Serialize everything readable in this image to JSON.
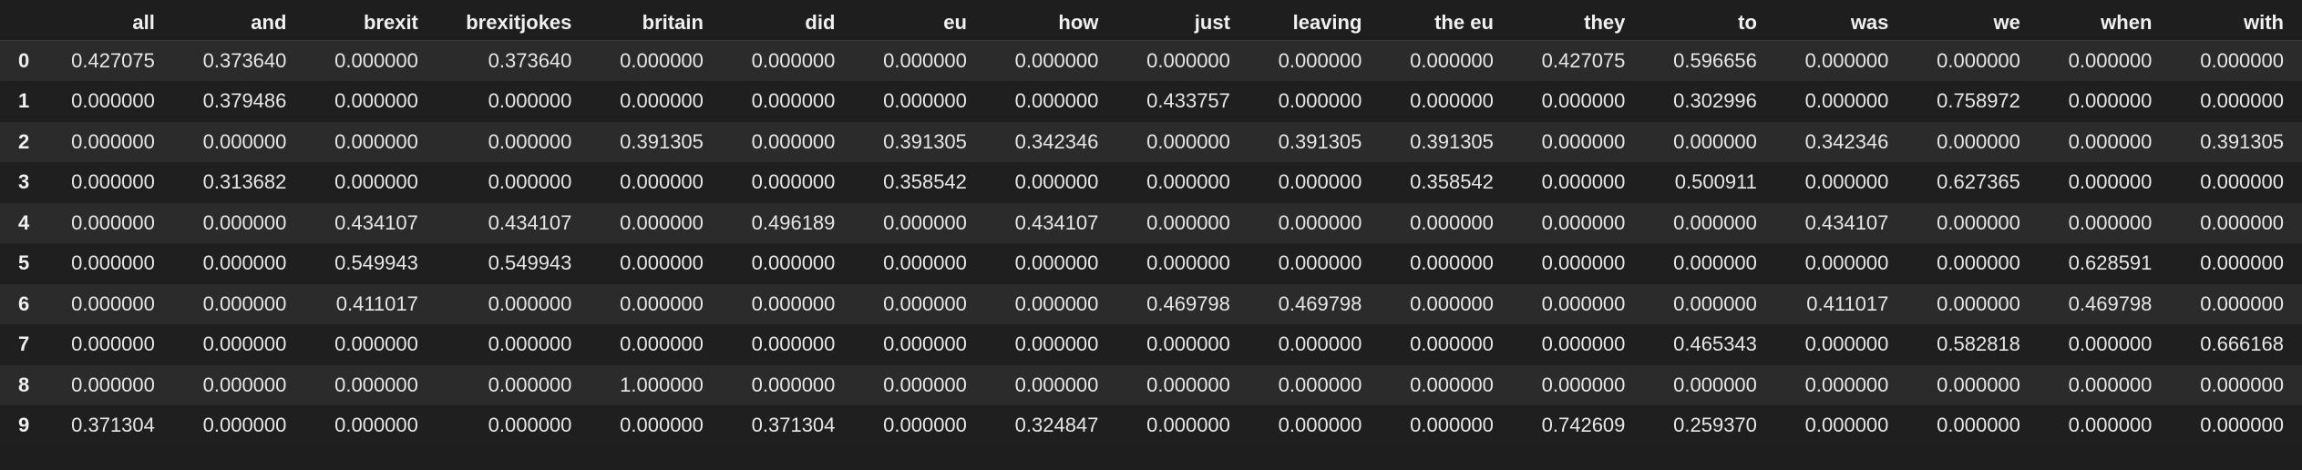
{
  "table": {
    "index_header": "",
    "columns": [
      "all",
      "and",
      "brexit",
      "brexitjokes",
      "britain",
      "did",
      "eu",
      "how",
      "just",
      "leaving",
      "the eu",
      "they",
      "to",
      "was",
      "we",
      "when",
      "with"
    ],
    "rows": [
      {
        "index": "0",
        "values": [
          "0.427075",
          "0.373640",
          "0.000000",
          "0.373640",
          "0.000000",
          "0.000000",
          "0.000000",
          "0.000000",
          "0.000000",
          "0.000000",
          "0.000000",
          "0.427075",
          "0.596656",
          "0.000000",
          "0.000000",
          "0.000000",
          "0.000000"
        ]
      },
      {
        "index": "1",
        "values": [
          "0.000000",
          "0.379486",
          "0.000000",
          "0.000000",
          "0.000000",
          "0.000000",
          "0.000000",
          "0.000000",
          "0.433757",
          "0.000000",
          "0.000000",
          "0.000000",
          "0.302996",
          "0.000000",
          "0.758972",
          "0.000000",
          "0.000000"
        ]
      },
      {
        "index": "2",
        "values": [
          "0.000000",
          "0.000000",
          "0.000000",
          "0.000000",
          "0.391305",
          "0.000000",
          "0.391305",
          "0.342346",
          "0.000000",
          "0.391305",
          "0.391305",
          "0.000000",
          "0.000000",
          "0.342346",
          "0.000000",
          "0.000000",
          "0.391305"
        ]
      },
      {
        "index": "3",
        "values": [
          "0.000000",
          "0.313682",
          "0.000000",
          "0.000000",
          "0.000000",
          "0.000000",
          "0.358542",
          "0.000000",
          "0.000000",
          "0.000000",
          "0.358542",
          "0.000000",
          "0.500911",
          "0.000000",
          "0.627365",
          "0.000000",
          "0.000000"
        ]
      },
      {
        "index": "4",
        "values": [
          "0.000000",
          "0.000000",
          "0.434107",
          "0.434107",
          "0.000000",
          "0.496189",
          "0.000000",
          "0.434107",
          "0.000000",
          "0.000000",
          "0.000000",
          "0.000000",
          "0.000000",
          "0.434107",
          "0.000000",
          "0.000000",
          "0.000000"
        ]
      },
      {
        "index": "5",
        "values": [
          "0.000000",
          "0.000000",
          "0.549943",
          "0.549943",
          "0.000000",
          "0.000000",
          "0.000000",
          "0.000000",
          "0.000000",
          "0.000000",
          "0.000000",
          "0.000000",
          "0.000000",
          "0.000000",
          "0.000000",
          "0.628591",
          "0.000000"
        ]
      },
      {
        "index": "6",
        "values": [
          "0.000000",
          "0.000000",
          "0.411017",
          "0.000000",
          "0.000000",
          "0.000000",
          "0.000000",
          "0.000000",
          "0.469798",
          "0.469798",
          "0.000000",
          "0.000000",
          "0.000000",
          "0.411017",
          "0.000000",
          "0.469798",
          "0.000000"
        ]
      },
      {
        "index": "7",
        "values": [
          "0.000000",
          "0.000000",
          "0.000000",
          "0.000000",
          "0.000000",
          "0.000000",
          "0.000000",
          "0.000000",
          "0.000000",
          "0.000000",
          "0.000000",
          "0.000000",
          "0.465343",
          "0.000000",
          "0.582818",
          "0.000000",
          "0.666168"
        ]
      },
      {
        "index": "8",
        "values": [
          "0.000000",
          "0.000000",
          "0.000000",
          "0.000000",
          "1.000000",
          "0.000000",
          "0.000000",
          "0.000000",
          "0.000000",
          "0.000000",
          "0.000000",
          "0.000000",
          "0.000000",
          "0.000000",
          "0.000000",
          "0.000000",
          "0.000000"
        ]
      },
      {
        "index": "9",
        "values": [
          "0.371304",
          "0.000000",
          "0.000000",
          "0.000000",
          "0.000000",
          "0.371304",
          "0.000000",
          "0.324847",
          "0.000000",
          "0.000000",
          "0.000000",
          "0.742609",
          "0.259370",
          "0.000000",
          "0.000000",
          "0.000000",
          "0.000000"
        ]
      }
    ]
  }
}
